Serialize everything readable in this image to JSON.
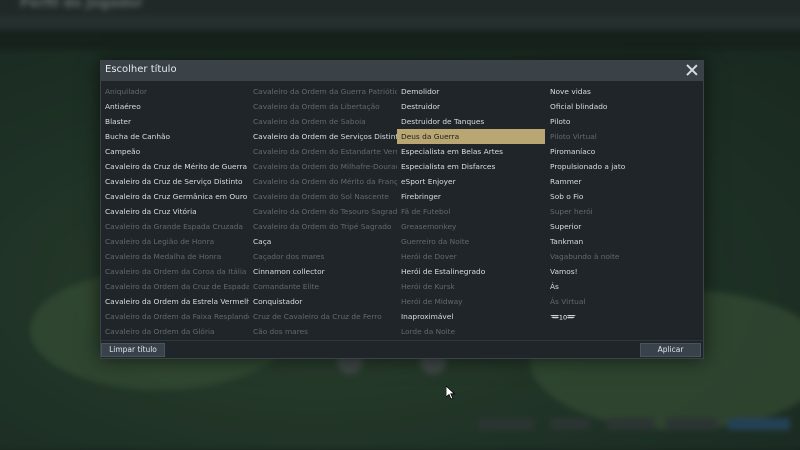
{
  "background": {
    "page_title": "Perfil do Jogador"
  },
  "dialog": {
    "title": "Escolher título",
    "clear_button": "Limpar título",
    "apply_button": "Aplicar",
    "columns": [
      [
        {
          "label": "Aniquilador",
          "enabled": false
        },
        {
          "label": "Antiaéreo",
          "enabled": true
        },
        {
          "label": "Blaster",
          "enabled": true
        },
        {
          "label": "Bucha de Canhão",
          "enabled": true
        },
        {
          "label": "Campeão",
          "enabled": true
        },
        {
          "label": "Cavaleiro da Cruz de Mérito de Guerra",
          "enabled": true
        },
        {
          "label": "Cavaleiro da Cruz de Serviço Distinto",
          "enabled": true
        },
        {
          "label": "Cavaleiro da Cruz Germânica em Ouro",
          "enabled": true
        },
        {
          "label": "Cavaleiro da Cruz Vitória",
          "enabled": true
        },
        {
          "label": "Cavaleiro da Grande Espada Cruzada",
          "enabled": false
        },
        {
          "label": "Cavaleiro da Legião de Honra",
          "enabled": false
        },
        {
          "label": "Cavaleiro da Medalha de Honra",
          "enabled": false
        },
        {
          "label": "Cavaleiro da Ordem da Coroa da Itália",
          "enabled": false
        },
        {
          "label": "Cavaleiro da Ordem da Cruz de Espada",
          "enabled": false
        },
        {
          "label": "Cavaleiro da Ordem da Estrela Vermelha",
          "enabled": true
        },
        {
          "label": "Cavaleiro da Ordem da Faixa Resplandecente",
          "enabled": false
        },
        {
          "label": "Cavaleiro da Ordem da Glória",
          "enabled": false
        }
      ],
      [
        {
          "label": "Cavaleiro da Ordem da Guerra Patriótica",
          "enabled": false
        },
        {
          "label": "Cavaleiro da Ordem da Libertação",
          "enabled": false
        },
        {
          "label": "Cavaleiro da Ordem de Saboia",
          "enabled": false
        },
        {
          "label": "Cavaleiro da Ordem de Serviços Distintos",
          "enabled": true
        },
        {
          "label": "Cavaleiro da Ordem do Estandarte Vermelho",
          "enabled": false
        },
        {
          "label": "Cavaleiro da Ordem do Milhafre-Dourado",
          "enabled": false
        },
        {
          "label": "Cavaleiro da Ordem do Mérito da França",
          "enabled": false
        },
        {
          "label": "Cavaleiro da Ordem do Sol Nascente",
          "enabled": false
        },
        {
          "label": "Cavaleiro da Ordem do Tesouro Sagrado",
          "enabled": false
        },
        {
          "label": "Cavaleiro da Ordem do Tripé Sagrado",
          "enabled": false
        },
        {
          "label": "Caça",
          "enabled": true
        },
        {
          "label": "Caçador dos mares",
          "enabled": false
        },
        {
          "label": "Cinnamon collector",
          "enabled": true
        },
        {
          "label": "Comandante Elite",
          "enabled": false
        },
        {
          "label": "Conquistador",
          "enabled": true
        },
        {
          "label": "Cruz de Cavaleiro da Cruz de Ferro",
          "enabled": false
        },
        {
          "label": "Cão dos mares",
          "enabled": false
        }
      ],
      [
        {
          "label": "Demolidor",
          "enabled": true
        },
        {
          "label": "Destruidor",
          "enabled": true
        },
        {
          "label": "Destruidor de Tanques",
          "enabled": true
        },
        {
          "label": "Deus da Guerra",
          "enabled": true,
          "selected": true
        },
        {
          "label": "Especialista em Belas Artes",
          "enabled": true
        },
        {
          "label": "Especialista em Disfarces",
          "enabled": true
        },
        {
          "label": "eSport Enjoyer",
          "enabled": true
        },
        {
          "label": "Firebringer",
          "enabled": true
        },
        {
          "label": "Fã de Futebol",
          "enabled": false
        },
        {
          "label": "Greasemonkey",
          "enabled": false
        },
        {
          "label": "Guerreiro da Noite",
          "enabled": false
        },
        {
          "label": "Herói de Dover",
          "enabled": false
        },
        {
          "label": "Herói de Estalinegrado",
          "enabled": true
        },
        {
          "label": "Herói de Kursk",
          "enabled": false
        },
        {
          "label": "Herói de Midway",
          "enabled": false
        },
        {
          "label": "Inaproximável",
          "enabled": true
        },
        {
          "label": "Lorde da Noite",
          "enabled": false
        }
      ],
      [
        {
          "label": "Nove vidas",
          "enabled": true
        },
        {
          "label": "Oficial blindado",
          "enabled": true
        },
        {
          "label": "Piloto",
          "enabled": true
        },
        {
          "label": "Piloto Virtual",
          "enabled": false
        },
        {
          "label": "Piromaníaco",
          "enabled": true
        },
        {
          "label": "Propulsionado a jato",
          "enabled": true
        },
        {
          "label": "Rammer",
          "enabled": true
        },
        {
          "label": "Sob o Fio",
          "enabled": true
        },
        {
          "label": "Super herói",
          "enabled": false
        },
        {
          "label": "Superior",
          "enabled": true
        },
        {
          "label": "Tankman",
          "enabled": true
        },
        {
          "label": "Vagabundo à noite",
          "enabled": false
        },
        {
          "label": "Vamos!",
          "enabled": true
        },
        {
          "label": "Ás",
          "enabled": true
        },
        {
          "label": "Ás Virtual",
          "enabled": false
        },
        {
          "label": "10",
          "enabled": true,
          "badge": true
        }
      ]
    ]
  },
  "colors": {
    "selected_bg": "#b9a672",
    "enabled_text": "#d9dde0",
    "disabled_text": "#626a6e"
  }
}
